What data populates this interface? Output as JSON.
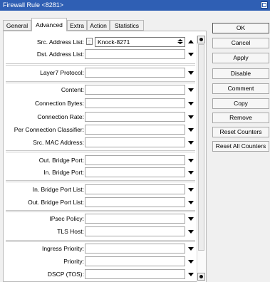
{
  "window": {
    "title": "Firewall Rule <8281>"
  },
  "tabs": [
    {
      "label": "General"
    },
    {
      "label": "Advanced"
    },
    {
      "label": "Extra"
    },
    {
      "label": "Action"
    },
    {
      "label": "Statistics"
    }
  ],
  "form": {
    "src_address_list": {
      "label": "Src. Address List:",
      "value": "Knock-8271"
    },
    "dst_address_list": {
      "label": "Dst. Address List:"
    },
    "layer7_protocol": {
      "label": "Layer7 Protocol:"
    },
    "content": {
      "label": "Content:"
    },
    "connection_bytes": {
      "label": "Connection Bytes:"
    },
    "connection_rate": {
      "label": "Connection Rate:"
    },
    "per_connection_classifier": {
      "label": "Per Connection Classifier:"
    },
    "src_mac_address": {
      "label": "Src. MAC Address:"
    },
    "out_bridge_port": {
      "label": "Out. Bridge Port:"
    },
    "in_bridge_port": {
      "label": "In. Bridge Port:"
    },
    "in_bridge_port_list": {
      "label": "In. Bridge Port List:"
    },
    "out_bridge_port_list": {
      "label": "Out. Bridge Port List:"
    },
    "ipsec_policy": {
      "label": "IPsec Policy:"
    },
    "tls_host": {
      "label": "TLS Host:"
    },
    "ingress_priority": {
      "label": "Ingress Priority:"
    },
    "priority": {
      "label": "Priority:"
    },
    "dscp_tos": {
      "label": "DSCP (TOS):"
    }
  },
  "buttons": {
    "ok": "OK",
    "cancel": "Cancel",
    "apply": "Apply",
    "disable": "Disable",
    "comment": "Comment",
    "copy": "Copy",
    "remove": "Remove",
    "reset_counters": "Reset Counters",
    "reset_all_counters": "Reset All Counters"
  },
  "colors": {
    "titlebar": "#2f5fb4",
    "panel": "#ffffff",
    "background": "#f0f0f0"
  },
  "icons": {
    "window": "window-restore-icon",
    "dropdown": "dropdown-arrow-icon",
    "scroll": "scroll-dot-icon"
  }
}
